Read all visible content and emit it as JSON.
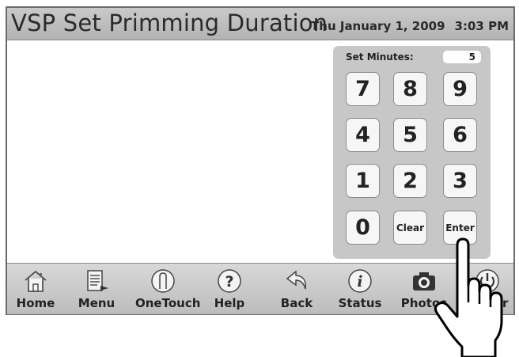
{
  "header": {
    "title": "VSP Set Primming Duration",
    "date": "Thu January 1, 2009",
    "time": "3:03 PM"
  },
  "keypad": {
    "label": "Set Minutes:",
    "value": "5",
    "keys": [
      "7",
      "8",
      "9",
      "4",
      "5",
      "6",
      "1",
      "2",
      "3",
      "0",
      "Clear",
      "Enter"
    ]
  },
  "toolbar": {
    "items": [
      {
        "label": "Home",
        "icon": "house-icon"
      },
      {
        "label": "Menu",
        "icon": "menu-document-icon"
      },
      {
        "label": "OneTouch",
        "icon": "finger-touch-icon"
      },
      {
        "label": "Help",
        "icon": "question-icon"
      },
      {
        "label": "Back",
        "icon": "back-arrow-icon"
      },
      {
        "label": "Status",
        "icon": "info-icon"
      },
      {
        "label": "Photos",
        "icon": "camera-icon"
      },
      {
        "label": "Power",
        "icon": "power-icon"
      }
    ]
  },
  "colors": {
    "header_bg": "#c0c0c0",
    "keypad_bg": "#c7c7c7",
    "key_bg": "#f6f6f6",
    "toolbar_bg": "#cbcbcb"
  }
}
